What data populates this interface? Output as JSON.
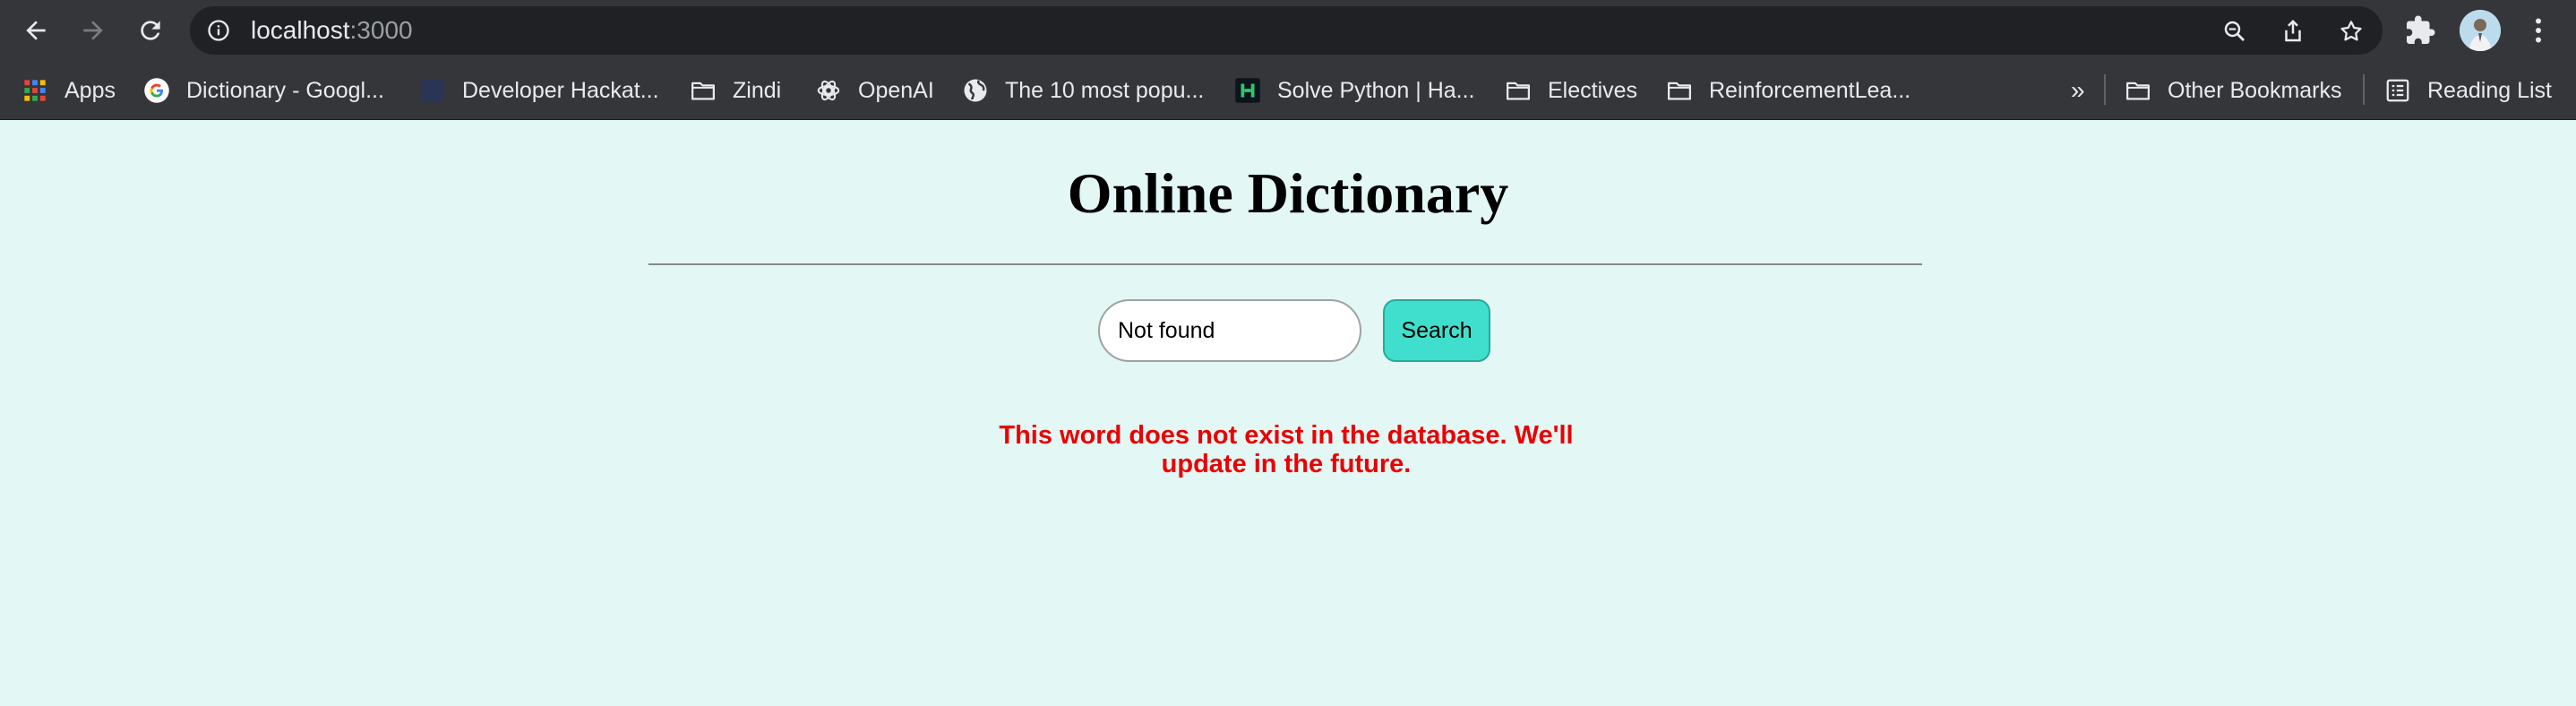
{
  "browser": {
    "url_host": "localhost",
    "url_port": ":3000",
    "bookmarks": [
      {
        "label": "Apps",
        "icon": "apps-grid-icon"
      },
      {
        "label": "Dictionary - Googl...",
        "icon": "google-icon"
      },
      {
        "label": "Developer Hackat...",
        "icon": "site-favicon"
      },
      {
        "label": "Zindi",
        "icon": "folder-icon"
      },
      {
        "label": "OpenAI",
        "icon": "openai-icon"
      },
      {
        "label": "The 10 most popu...",
        "icon": "globe-icon"
      },
      {
        "label": "Solve Python | Ha...",
        "icon": "hackerrank-icon"
      },
      {
        "label": "Electives",
        "icon": "folder-icon"
      },
      {
        "label": "ReinforcementLea...",
        "icon": "folder-icon"
      }
    ],
    "overflow_label": "»",
    "other_bookmarks": "Other Bookmarks",
    "reading_list": "Reading List"
  },
  "page": {
    "title": "Online Dictionary",
    "search_value": "Not found",
    "search_button": "Search",
    "error_message": "This word does not exist in the database. We'll update in the future."
  },
  "colors": {
    "page_background": "#e3f7f5",
    "button_accent": "#40dfcd",
    "error_text": "#ea0000"
  }
}
